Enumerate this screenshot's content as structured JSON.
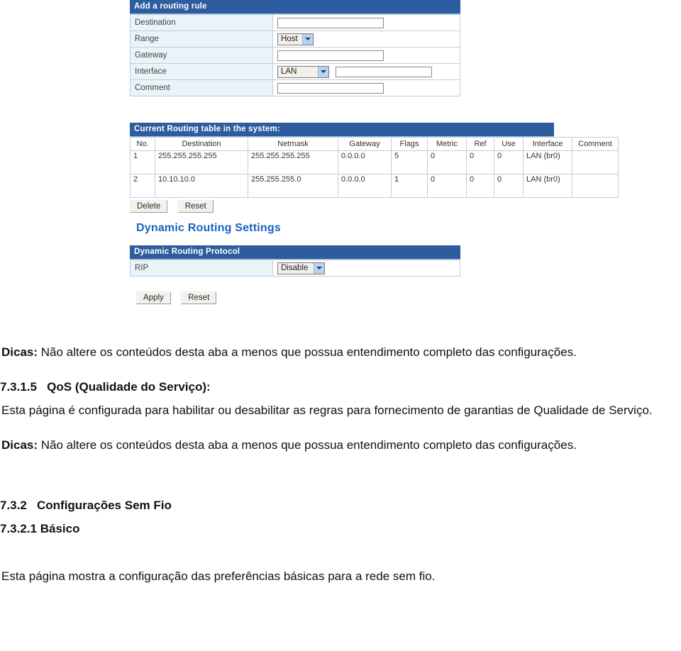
{
  "router_ui": {
    "add_rule_panel": {
      "title": "Add a routing rule",
      "rows": [
        {
          "label": "Destination",
          "control": "textbox",
          "value": ""
        },
        {
          "label": "Range",
          "control": "select",
          "value": "Host"
        },
        {
          "label": "Gateway",
          "control": "textbox",
          "value": ""
        },
        {
          "label": "Interface",
          "control": "select+textbox",
          "value": "LAN",
          "extra_value": ""
        },
        {
          "label": "Comment",
          "control": "textbox",
          "value": ""
        }
      ]
    },
    "routing_table": {
      "title": "Current Routing table in the system:",
      "columns": [
        "No.",
        "Destination",
        "Netmask",
        "Gateway",
        "Flags",
        "Metric",
        "Ref",
        "Use",
        "Interface",
        "Comment"
      ],
      "rows": [
        {
          "no": "1",
          "destination": "255.255.255.255",
          "netmask": "255.255.255.255",
          "gateway": "0.0.0.0",
          "flags": "5",
          "metric": "0",
          "ref": "0",
          "use": "0",
          "interface": "LAN (br0)",
          "comment": ""
        },
        {
          "no": "2",
          "destination": "10.10.10.0",
          "netmask": "255.255.255.0",
          "gateway": "0.0.0.0",
          "flags": "1",
          "metric": "0",
          "ref": "0",
          "use": "0",
          "interface": "LAN (br0)",
          "comment": ""
        }
      ]
    },
    "table_buttons": {
      "delete_label": "Delete",
      "reset_label": "Reset"
    },
    "dynamic_routing": {
      "heading": "Dynamic Routing Settings",
      "heading_color": "#1763c0",
      "panel_title": "Dynamic Routing Protocol",
      "rip_label": "RIP",
      "rip_value": "Disable",
      "apply_label": "Apply",
      "reset_label": "Reset"
    },
    "colors": {
      "panel_header_blue": "#2d5d9f",
      "label_cell_blue": "#e9f3f8",
      "border_blue": "#b9cfe0",
      "select_arrow_blue": "#b9d2ef"
    }
  },
  "document": {
    "tip1": {
      "bold": "Dicas:",
      "text": " Não altere os conteúdos desta aba a menos que possua entendimento completo das configurações."
    },
    "qos_heading": {
      "number": "7.3.1.5",
      "title": "QoS (Qualidade do Serviço):"
    },
    "qos_body": "Esta página é configurada para habilitar ou desabilitar as regras para fornecimento de garantias de Qualidade de Serviço.",
    "tip2": {
      "bold": "Dicas:",
      "text": " Não altere os conteúdos desta aba a menos que possua entendimento completo das configurações."
    },
    "wireless_heading": {
      "number": "7.3.2",
      "title": "Configurações Sem Fio"
    },
    "basic_heading": {
      "number": "7.3.2.1",
      "title": "Básico"
    },
    "basic_body": "Esta página mostra a configuração das preferências básicas para a rede sem fio."
  }
}
